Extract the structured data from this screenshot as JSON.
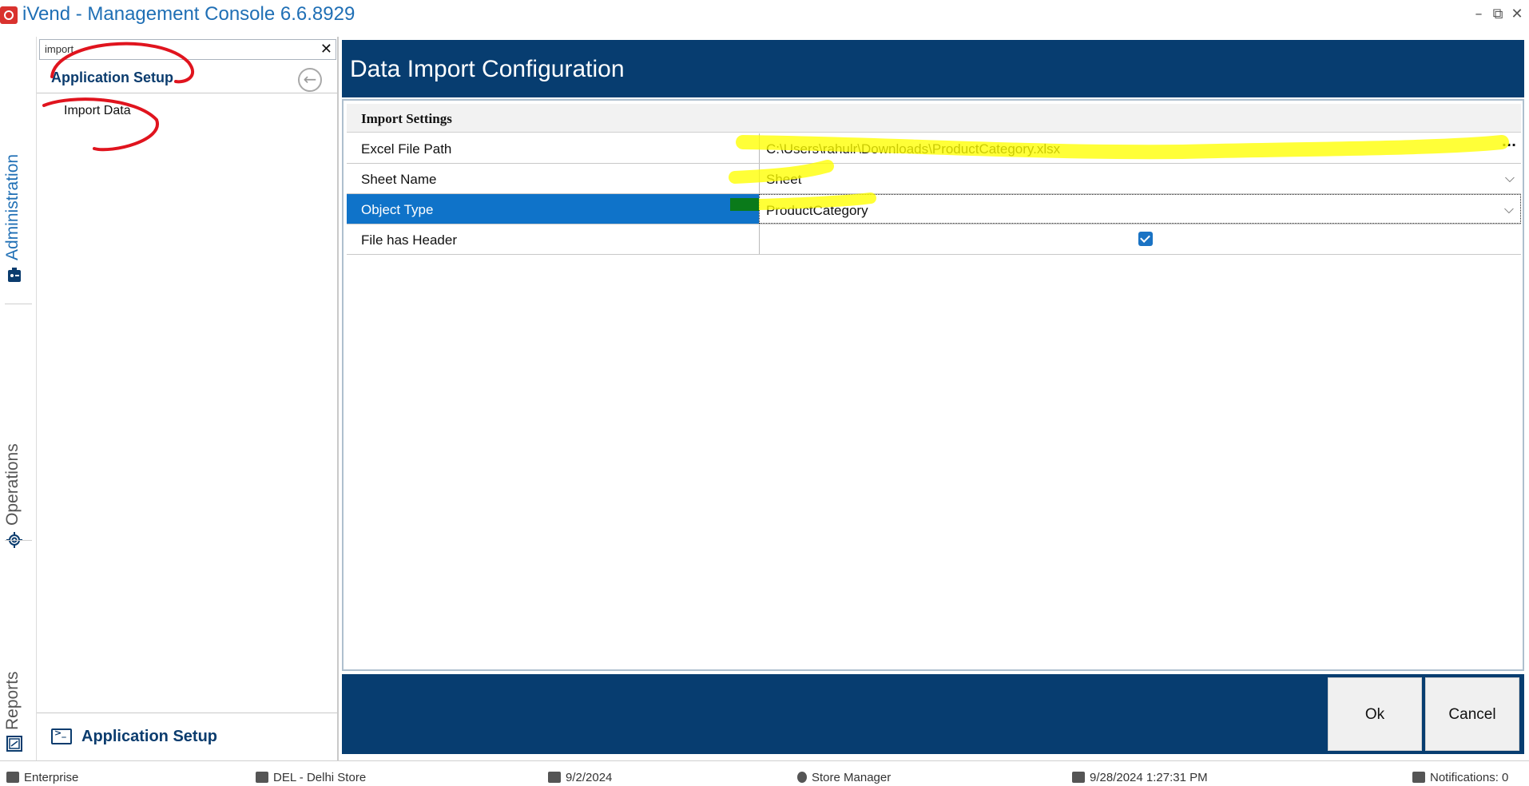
{
  "window": {
    "title": "iVend - Management Console  6.6.8929",
    "minimize": "–",
    "restore": "⧉",
    "close": "✕"
  },
  "side_tabs": [
    {
      "label": "Administration",
      "icon": "admin-icon",
      "active": true
    },
    {
      "label": "Operations",
      "icon": "gear-icon",
      "active": false
    },
    {
      "label": "Reports",
      "icon": "reports-icon",
      "active": false
    }
  ],
  "nav": {
    "search_value": "import",
    "clear_label": "✕",
    "header_title": "Application Setup",
    "back_label": "←",
    "items": [
      {
        "label": "Import Data"
      }
    ],
    "footer_title": "Application Setup"
  },
  "main": {
    "title": "Data Import Configuration",
    "section_title": "Import Settings",
    "properties": [
      {
        "label": "Excel File Path",
        "value": "C:\\Users\\rahulr\\Downloads\\ProductCategory.xlsx",
        "editor": "ellipsis"
      },
      {
        "label": "Sheet Name",
        "value": "Sheet",
        "editor": "dropdown"
      },
      {
        "label": "Object Type",
        "value": "ProductCategory",
        "editor": "dropdown",
        "selected": true
      },
      {
        "label": "File has Header",
        "value": "",
        "editor": "checkbox",
        "checked": true
      }
    ],
    "ellipsis_label": "···",
    "dropdown_arrow": "⌵"
  },
  "actions": {
    "ok_label": "Ok",
    "cancel_label": "Cancel"
  },
  "status": {
    "company": "Enterprise",
    "store": "DEL - Delhi  Store",
    "date": "9/2/2024",
    "role": "Store Manager",
    "login_time": "9/28/2024 1:27:31 PM",
    "notifications": "Notifications: 0"
  },
  "colors": {
    "header_blue": "#073d70",
    "accent_text": "#1f6fb5",
    "selection_blue": "#0f73c9",
    "highlight_yellow": "#ffff00",
    "annotation_red": "#e0141e",
    "annotation_green": "#0a7a1a"
  }
}
